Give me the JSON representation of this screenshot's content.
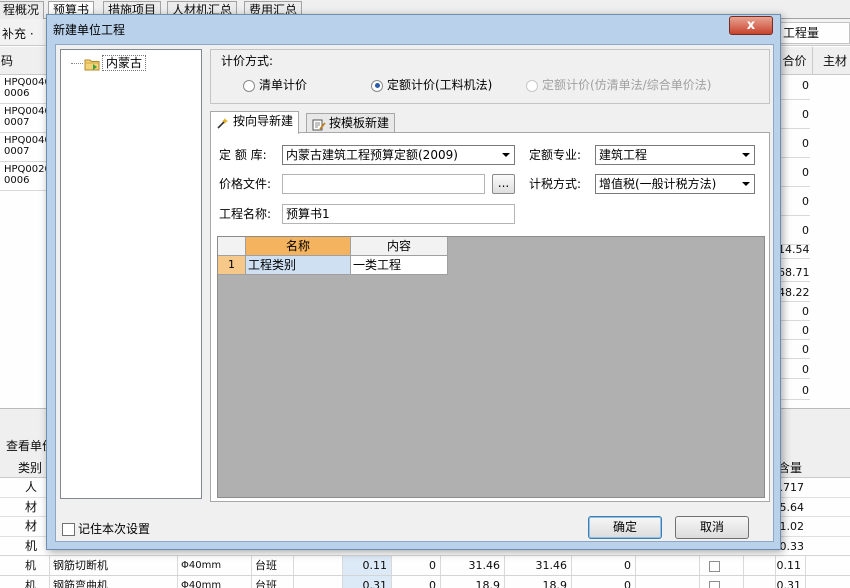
{
  "background": {
    "tabs": [
      "程概况",
      "预算书",
      "措施项目",
      "人材机汇总",
      "费用汇总"
    ],
    "active_tab": "预算书",
    "toolbar_supplement": "补充 ·",
    "toolbar_quantity_tab": "工程量",
    "grid_header_left": "码",
    "grid_header_price": "合价",
    "grid_header_main": "主材",
    "left_codes": [
      {
        "line1": "HPQ0040",
        "line2": "0006"
      },
      {
        "line1": "HPQ0040",
        "line2": "0007"
      },
      {
        "line1": "HPQ0040",
        "line2": "0007"
      },
      {
        "line1": "HPQ0020",
        "line2": "0006"
      }
    ],
    "right_values": [
      "0",
      "0",
      "0",
      "0",
      "0",
      "0",
      "14.54",
      "68.71",
      "48.22",
      "0",
      "0",
      "0",
      "0",
      "0"
    ],
    "lower_title": "查看单价",
    "lower_header_category": "类别",
    "lower_header_qty": "含量",
    "lower_categories": [
      "人",
      "材",
      "材",
      "机"
    ],
    "lower_qty_values": [
      "0.717",
      "5.64",
      "1.02",
      "0.33"
    ],
    "bottom_rows": [
      {
        "cat": "机",
        "name": "钢筋切断机",
        "spec": "Φ40mm",
        "unit": "台班",
        "v1": "0.11",
        "v2": "0",
        "v3": "31.46",
        "v4": "31.46",
        "v5": "0",
        "qty": "0.11"
      },
      {
        "cat": "机",
        "name": "钢筋弯曲机",
        "spec": "Φ40mm",
        "unit": "台班",
        "v1": "0.31",
        "v2": "0",
        "v3": "18.9",
        "v4": "18.9",
        "v5": "0",
        "qty": "0.31"
      }
    ]
  },
  "dialog": {
    "title": "新建单位工程",
    "close_label": "x",
    "tree_root": "内蒙古",
    "pricing": {
      "legend": "计价方式:",
      "options": [
        {
          "label": "清单计价",
          "selected": false,
          "enabled": true
        },
        {
          "label": "定额计价(工料机法)",
          "selected": true,
          "enabled": true
        },
        {
          "label": "定额计价(仿清单法/综合单价法)",
          "selected": false,
          "enabled": false
        }
      ]
    },
    "tabs": [
      {
        "label": "按向导新建",
        "active": true,
        "icon": "wizard-icon"
      },
      {
        "label": "按模板新建",
        "active": false,
        "icon": "template-icon"
      }
    ],
    "form": {
      "quota_lib_label": "定 额 库:",
      "quota_lib_value": "内蒙古建筑工程预算定额(2009)",
      "specialty_label": "定额专业:",
      "specialty_value": "建筑工程",
      "price_file_label": "价格文件:",
      "price_file_value": "",
      "browse_label": "...",
      "tax_label": "计税方式:",
      "tax_value": "增值税(一般计税方法)",
      "project_name_label": "工程名称:",
      "project_name_value": "预算书1"
    },
    "property_table": {
      "columns": [
        "名称",
        "内容"
      ],
      "rows": [
        {
          "index": "1",
          "name": "工程类别",
          "content": "一类工程"
        }
      ]
    },
    "remember_label": "记住本次设置",
    "ok_label": "确定",
    "cancel_label": "取消",
    "colors": {
      "title_bar": "#b9d1ea",
      "header_highlight": "#f4b35e",
      "row_header": "#f6c98a",
      "cell_selected": "#cfe0f3",
      "close_button": "#c7432d"
    }
  }
}
